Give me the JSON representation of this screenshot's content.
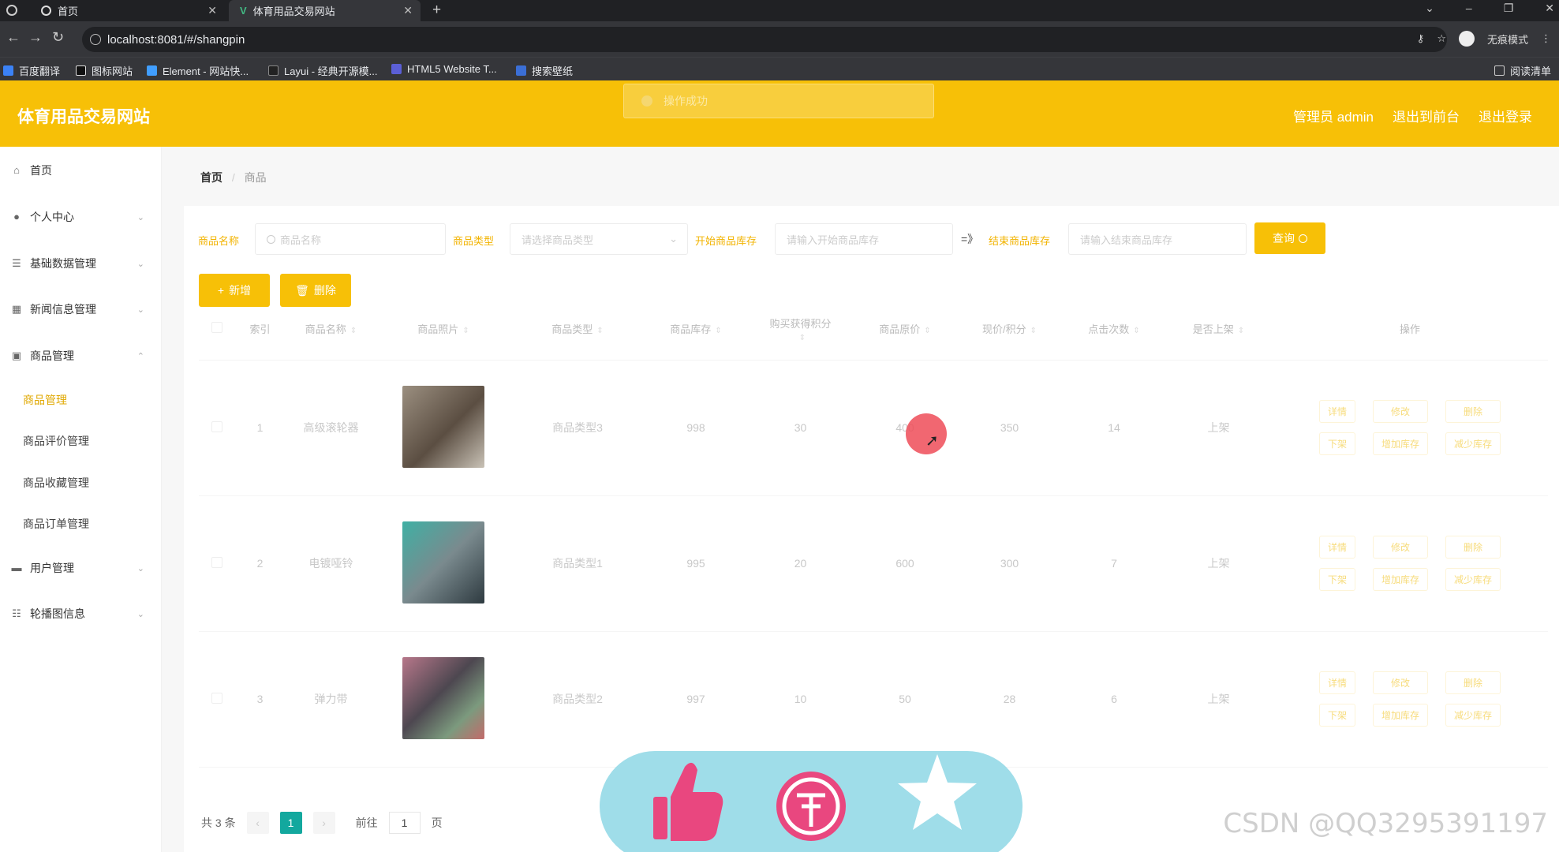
{
  "browser": {
    "tabs": [
      {
        "title": "首页"
      },
      {
        "title": "体育用品交易网站"
      }
    ],
    "url": "localhost:8081/#/shangpin",
    "incognito_label": "无痕模式",
    "bookmarks": [
      "百度翻译",
      "图标网站",
      "Element - 网站快...",
      "Layui - 经典开源模...",
      "HTML5 Website T...",
      "搜索壁纸"
    ],
    "reading_list": "阅读清单"
  },
  "app": {
    "title": "体育用品交易网站",
    "toast": "操作成功",
    "header_links": [
      "管理员 admin",
      "退出到前台",
      "退出登录"
    ]
  },
  "sidebar": {
    "items": [
      {
        "label": "首页",
        "icon": "home-icon"
      },
      {
        "label": "个人中心",
        "icon": "user-icon"
      },
      {
        "label": "基础数据管理",
        "icon": "list-icon"
      },
      {
        "label": "新闻信息管理",
        "icon": "grid-icon"
      },
      {
        "label": "商品管理",
        "icon": "lock-icon"
      },
      {
        "label": "用户管理",
        "icon": "monitor-icon"
      },
      {
        "label": "轮播图信息",
        "icon": "sliders-icon"
      }
    ],
    "sub_items": [
      "商品管理",
      "商品评价管理",
      "商品收藏管理",
      "商品订单管理"
    ]
  },
  "breadcrumb": {
    "home": "首页",
    "current": "商品"
  },
  "filters": {
    "name_label": "商品名称",
    "name_placeholder": "商品名称",
    "type_label": "商品类型",
    "type_placeholder": "请选择商品类型",
    "stock_start_label": "开始商品库存",
    "stock_start_placeholder": "请输入开始商品库存",
    "arrow": "=》",
    "stock_end_label": "结束商品库存",
    "stock_end_placeholder": "请输入结束商品库存",
    "search_button": "查询"
  },
  "actions": {
    "add": "新增",
    "delete": "删除"
  },
  "table": {
    "headers": [
      "索引",
      "商品名称",
      "商品照片",
      "商品类型",
      "商品库存",
      "购买获得积分",
      "商品原价",
      "现价/积分",
      "点击次数",
      "是否上架",
      "操作"
    ],
    "rows": [
      {
        "index": "1",
        "name": "高级滚轮器",
        "type": "商品类型3",
        "stock": "998",
        "points": "30",
        "original_price": "400",
        "current_price": "350",
        "clicks": "14",
        "on_shelf": "上架",
        "thumb_color": "#6f6457"
      },
      {
        "index": "2",
        "name": "电镀哑铃",
        "type": "商品类型1",
        "stock": "995",
        "points": "20",
        "original_price": "600",
        "current_price": "300",
        "clicks": "7",
        "on_shelf": "上架",
        "thumb_color": "#4aa8a0"
      },
      {
        "index": "3",
        "name": "弹力带",
        "type": "商品类型2",
        "stock": "997",
        "points": "10",
        "original_price": "50",
        "current_price": "28",
        "clicks": "6",
        "on_shelf": "上架",
        "thumb_color": "#8a6b78"
      }
    ],
    "row_ops": [
      "详情",
      "修改",
      "删除",
      "下架",
      "增加库存",
      "减少库存"
    ]
  },
  "pagination": {
    "total": "共 3 条",
    "current": "1",
    "goto_prefix": "前往",
    "goto_value": "1",
    "goto_suffix": "页"
  },
  "watermark": "CSDN @QQ3295391197"
}
